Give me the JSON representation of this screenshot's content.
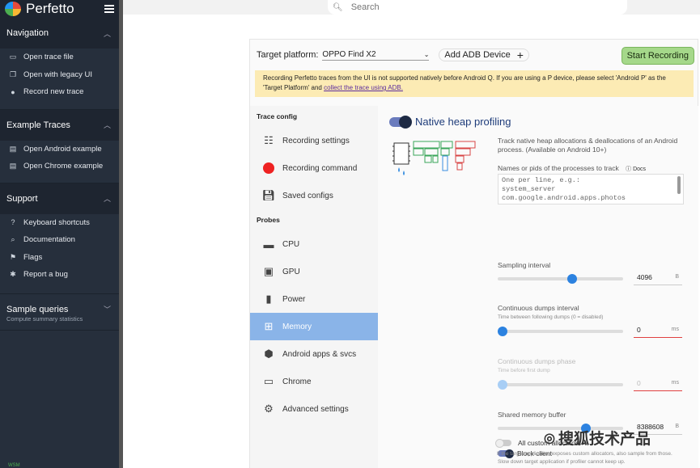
{
  "app": {
    "logo_text": "Perfetto"
  },
  "search": {
    "placeholder": "Search"
  },
  "sidebar": {
    "navigation": {
      "title": "Navigation",
      "items": [
        {
          "label": "Open trace file",
          "icon": "folder-icon"
        },
        {
          "label": "Open with legacy UI",
          "icon": "legacy-window-icon"
        },
        {
          "label": "Record new trace",
          "icon": "record-toggle-icon"
        }
      ]
    },
    "examples": {
      "title": "Example Traces",
      "items": [
        {
          "label": "Open Android example",
          "icon": "document-icon"
        },
        {
          "label": "Open Chrome example",
          "icon": "document-icon"
        }
      ]
    },
    "support": {
      "title": "Support",
      "items": [
        {
          "label": "Keyboard shortcuts",
          "icon": "help-icon"
        },
        {
          "label": "Documentation",
          "icon": "doc-search-icon"
        },
        {
          "label": "Flags",
          "icon": "flag-icon"
        },
        {
          "label": "Report a bug",
          "icon": "bug-icon"
        }
      ]
    },
    "queries": {
      "title": "Sample queries",
      "subtitle": "Compute summary statistics"
    },
    "footer": "WSM"
  },
  "record": {
    "target_platform_label": "Target platform:",
    "target_platform_value": "OPPO Find X2",
    "add_adb_label": "Add ADB Device",
    "start_label": "Start Recording",
    "warning_text": "Recording Perfetto traces from the UI is not supported natively before Android Q. If you are using a P device, please select 'Android P' as the 'Target Platform' and ",
    "warning_link": "collect the trace using ADB.",
    "nav": {
      "trace_config_header": "Trace config",
      "probes_header": "Probes",
      "items": [
        {
          "label": "Recording settings",
          "icon": "sliders-icon"
        },
        {
          "label": "Recording command",
          "icon": "record-dot-icon"
        },
        {
          "label": "Saved configs",
          "icon": "save-icon"
        },
        {
          "label": "CPU",
          "icon": "cpu-icon"
        },
        {
          "label": "GPU",
          "icon": "gpu-icon"
        },
        {
          "label": "Power",
          "icon": "battery-icon"
        },
        {
          "label": "Memory",
          "icon": "memory-chip-icon"
        },
        {
          "label": "Android apps & svcs",
          "icon": "android-icon"
        },
        {
          "label": "Chrome",
          "icon": "laptop-icon"
        },
        {
          "label": "Advanced settings",
          "icon": "gear-icon"
        }
      ],
      "active": "Memory"
    },
    "heap": {
      "title": "Native heap profiling",
      "enabled": true,
      "description": "Track native heap allocations & deallocations of an Android process. (Available on Android 10+)",
      "process_label": "Names or pids of the processes to track",
      "docs_label": "Docs",
      "process_placeholder": "One per line, e.g.:\nsystem_server\ncom.google.android.apps.photos",
      "sampling_label": "Sampling interval",
      "sampling_value": "4096",
      "sampling_unit": "B",
      "sampling_fraction": 0.6,
      "dumps_label": "Continuous dumps interval",
      "dumps_note": "Time between following dumps (0 = disabled)",
      "dumps_value": "0",
      "dumps_unit": "ms",
      "dumps_fraction": 0.0,
      "phase_label": "Continuous dumps phase",
      "phase_note": "Time before first dump",
      "phase_value": "0",
      "phase_unit": "ms",
      "phase_fraction": 0.0,
      "shm_label": "Shared memory buffer",
      "shm_value": "8388608",
      "shm_unit": "B",
      "shm_fraction": 0.72,
      "block_label": "Block client",
      "block_enabled": true,
      "block_note": "Slow down target application if profiler cannot keep up.",
      "custom_label": "All custom allocators",
      "custom_enabled": false,
      "custom_note": "If the target application exposes custom allocators, also sample from those."
    }
  },
  "watermark": "搜狐技术产品",
  "colors": {
    "sidebar": "#262f3c",
    "active_nav": "#8ab4e8",
    "start_button": "#a5d88a",
    "warning": "#fcebb4",
    "slider": "#2c82e0"
  }
}
